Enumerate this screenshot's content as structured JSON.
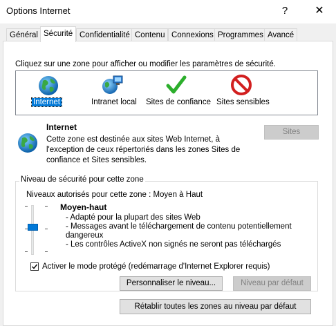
{
  "window": {
    "title": "Options Internet",
    "help_glyph": "?",
    "close_glyph": "✕"
  },
  "tabs": [
    {
      "label": "Général"
    },
    {
      "label": "Sécurité"
    },
    {
      "label": "Confidentialité"
    },
    {
      "label": "Contenu"
    },
    {
      "label": "Connexions"
    },
    {
      "label": "Programmes"
    },
    {
      "label": "Avancé"
    }
  ],
  "zones": {
    "prompt": "Cliquez sur une zone pour afficher ou modifier les paramètres de sécurité.",
    "items": [
      {
        "label": "Internet",
        "icon": "globe-icon",
        "selected": true
      },
      {
        "label": "Intranet local",
        "icon": "intranet-icon"
      },
      {
        "label": "Sites de confiance",
        "icon": "checkmark-icon"
      },
      {
        "label": "Sites sensibles",
        "icon": "forbidden-icon"
      }
    ]
  },
  "selected_zone": {
    "name": "Internet",
    "description": "Cette zone est destinée aux sites Web Internet, à l'exception de ceux répertoriés dans les zones Sites de confiance et Sites sensibles.",
    "sites_button": "Sites"
  },
  "security_level": {
    "group_title": "Niveau de sécurité pour cette zone",
    "allowed_levels": "Niveaux autorisés pour cette zone : Moyen à Haut",
    "level_name": "Moyen-haut",
    "level_fraction": 0.5,
    "details": [
      "- Adapté pour la plupart des sites Web",
      "- Messages avant le téléchargement de contenu potentiellement",
      "dangereux",
      "- Les contrôles ActiveX non signés ne seront pas téléchargés"
    ],
    "protected_mode_label": "Activer le mode protégé (redémarrage d'Internet Explorer requis)",
    "protected_mode_checked": true,
    "custom_level_button": "Personnaliser le niveau...",
    "default_level_button": "Niveau par défaut"
  },
  "reset_all_button": "Rétablir toutes les zones au niveau par défaut",
  "colors": {
    "selection": "#0078d7",
    "dialog_bg": "#f0f0f0"
  }
}
